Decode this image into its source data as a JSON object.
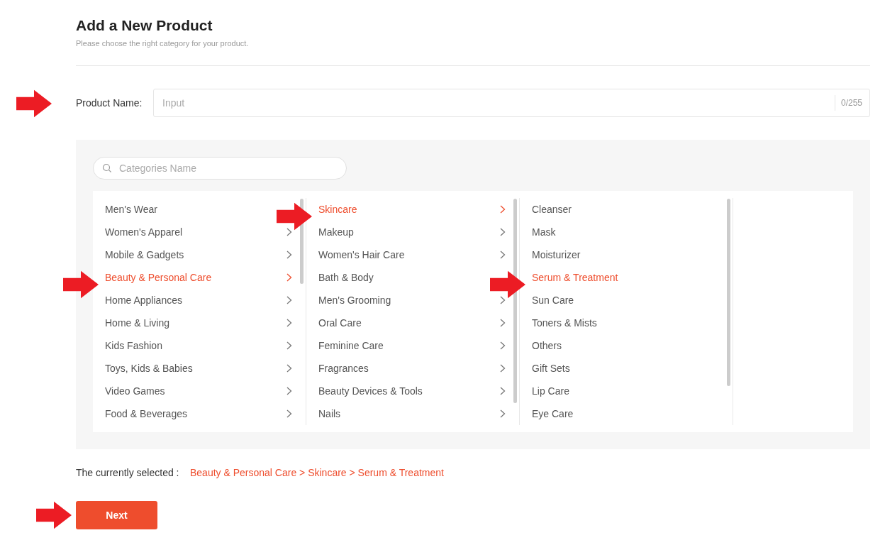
{
  "header": {
    "title": "Add a New Product",
    "subtitle": "Please choose the right category for your product."
  },
  "product_name": {
    "label": "Product Name:",
    "placeholder": "Input",
    "counter": "0/255",
    "arrow": true
  },
  "category_search": {
    "placeholder": "Categories Name"
  },
  "columns": [
    {
      "items": [
        {
          "label": "Men's Wear",
          "has_children": false,
          "selected": false,
          "arrow": false
        },
        {
          "label": "Women's Apparel",
          "has_children": true,
          "selected": false,
          "arrow": false
        },
        {
          "label": "Mobile & Gadgets",
          "has_children": true,
          "selected": false,
          "arrow": false
        },
        {
          "label": "Beauty & Personal Care",
          "has_children": true,
          "selected": true,
          "arrow": true
        },
        {
          "label": "Home Appliances",
          "has_children": true,
          "selected": false,
          "arrow": false
        },
        {
          "label": "Home & Living",
          "has_children": true,
          "selected": false,
          "arrow": false
        },
        {
          "label": "Kids Fashion",
          "has_children": true,
          "selected": false,
          "arrow": false
        },
        {
          "label": "Toys, Kids & Babies",
          "has_children": true,
          "selected": false,
          "arrow": false
        },
        {
          "label": "Video Games",
          "has_children": true,
          "selected": false,
          "arrow": false
        },
        {
          "label": "Food & Beverages",
          "has_children": true,
          "selected": false,
          "arrow": false
        }
      ]
    },
    {
      "items": [
        {
          "label": "Skincare",
          "has_children": true,
          "selected": true,
          "arrow": true
        },
        {
          "label": "Makeup",
          "has_children": true,
          "selected": false,
          "arrow": false
        },
        {
          "label": "Women's Hair Care",
          "has_children": true,
          "selected": false,
          "arrow": false
        },
        {
          "label": "Bath & Body",
          "has_children": false,
          "selected": false,
          "arrow": false
        },
        {
          "label": "Men's Grooming",
          "has_children": true,
          "selected": false,
          "arrow": false
        },
        {
          "label": "Oral Care",
          "has_children": true,
          "selected": false,
          "arrow": false
        },
        {
          "label": "Feminine Care",
          "has_children": true,
          "selected": false,
          "arrow": false
        },
        {
          "label": "Fragrances",
          "has_children": true,
          "selected": false,
          "arrow": false
        },
        {
          "label": "Beauty Devices & Tools",
          "has_children": true,
          "selected": false,
          "arrow": false
        },
        {
          "label": "Nails",
          "has_children": true,
          "selected": false,
          "arrow": false
        }
      ]
    },
    {
      "items": [
        {
          "label": "Cleanser",
          "has_children": false,
          "selected": false,
          "arrow": false
        },
        {
          "label": "Mask",
          "has_children": false,
          "selected": false,
          "arrow": false
        },
        {
          "label": "Moisturizer",
          "has_children": false,
          "selected": false,
          "arrow": false
        },
        {
          "label": "Serum & Treatment",
          "has_children": false,
          "selected": true,
          "arrow": true
        },
        {
          "label": "Sun Care",
          "has_children": false,
          "selected": false,
          "arrow": false
        },
        {
          "label": "Toners & Mists",
          "has_children": false,
          "selected": false,
          "arrow": false
        },
        {
          "label": "Others",
          "has_children": false,
          "selected": false,
          "arrow": false
        },
        {
          "label": "Gift Sets",
          "has_children": false,
          "selected": false,
          "arrow": false
        },
        {
          "label": "Lip Care",
          "has_children": false,
          "selected": false,
          "arrow": false
        },
        {
          "label": "Eye Care",
          "has_children": false,
          "selected": false,
          "arrow": false
        }
      ]
    }
  ],
  "selection": {
    "label": "The currently selected :",
    "path": "Beauty & Personal Care > Skincare > Serum & Treatment"
  },
  "next_button": {
    "label": "Next",
    "arrow": true
  }
}
